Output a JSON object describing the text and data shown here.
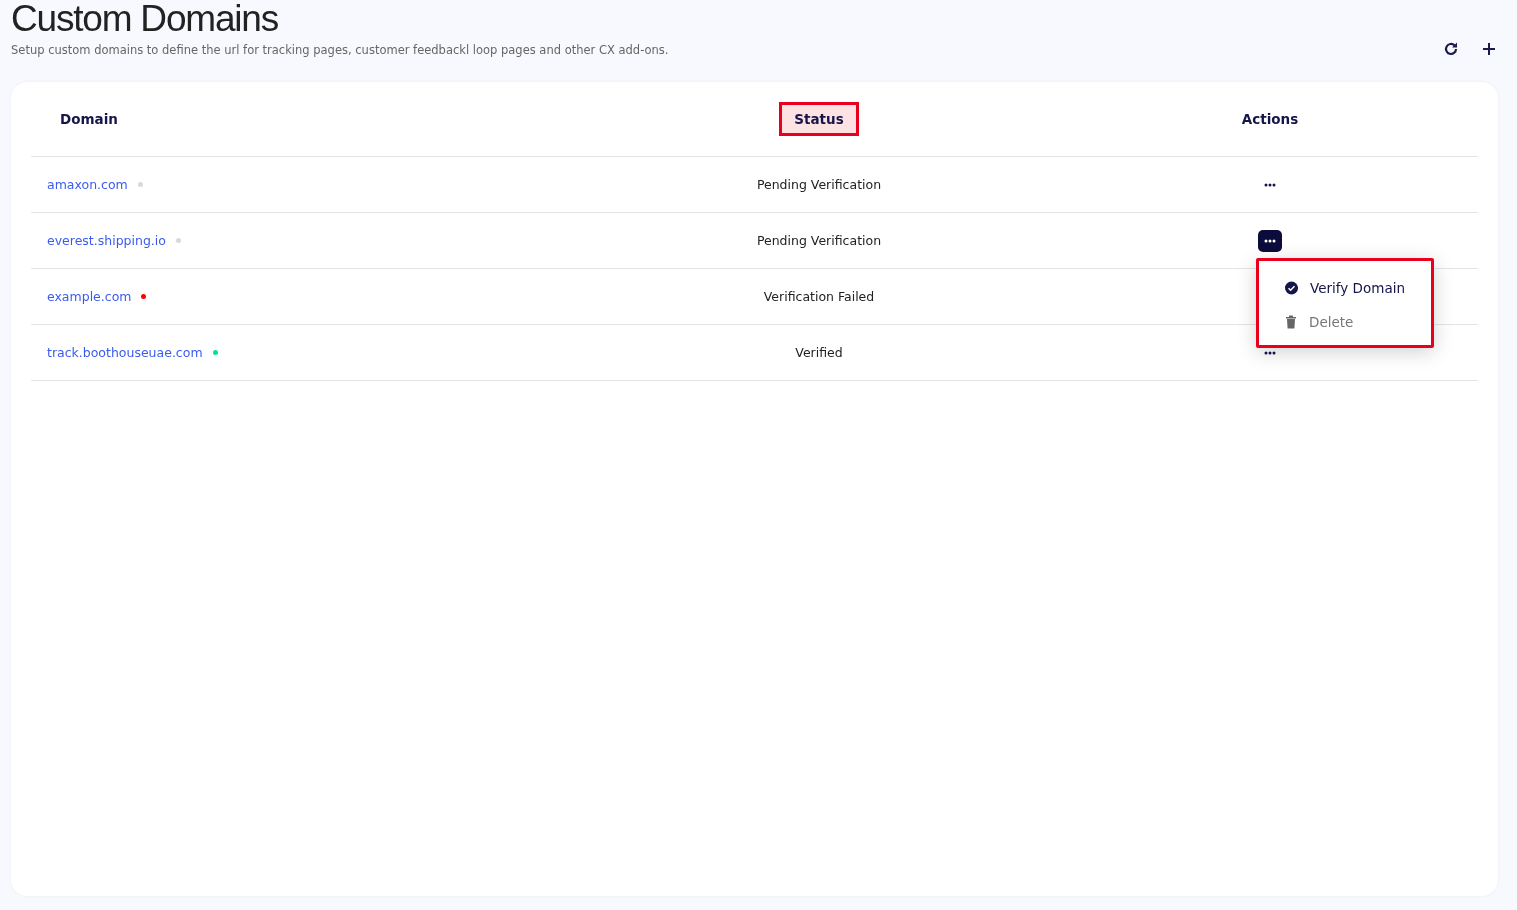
{
  "page": {
    "title": "Custom Domains",
    "subtitle": "Setup custom domains to define the url for tracking pages, customer feedbackl loop pages and other CX add-ons."
  },
  "table": {
    "columns": [
      {
        "label": "Domain",
        "highlighted": false
      },
      {
        "label": "Status",
        "highlighted": true
      },
      {
        "label": "Actions",
        "highlighted": false
      }
    ],
    "rows": [
      {
        "domain": "amaxon.com",
        "color": "#d9d9d9",
        "status": "Pending Verification",
        "menu_open": false
      },
      {
        "domain": "everest.shipping.io",
        "color": "#d9d9d9",
        "status": "Pending Verification",
        "menu_open": true
      },
      {
        "domain": "example.com",
        "color": "#ff0000",
        "status": "Verification Failed"
      },
      {
        "domain": "track.boothouseuae.com",
        "color": "#00e0a0",
        "status": "Verified",
        "menu_open": false
      }
    ]
  },
  "action_menu": {
    "highlighted": true,
    "items": [
      {
        "kind": "verify",
        "label": "Verify Domain",
        "disabled": false
      },
      {
        "kind": "delete",
        "label": "Delete",
        "disabled": true
      }
    ]
  }
}
